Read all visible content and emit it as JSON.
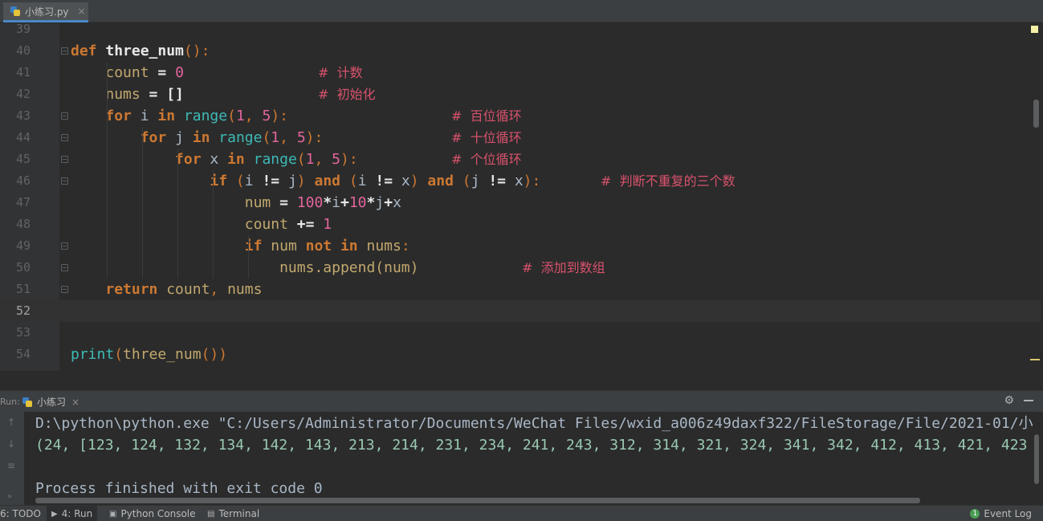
{
  "editor_tab": {
    "filename": "小练习.py",
    "close": "×"
  },
  "code_lines": [
    {
      "num": "39"
    },
    {
      "num": "40",
      "tokens": [
        [
          "kw",
          "def "
        ],
        [
          "fn",
          "three_num"
        ],
        [
          "punc",
          "():"
        ]
      ]
    },
    {
      "num": "41",
      "tokens": [
        [
          "pl",
          "    "
        ],
        [
          "id",
          "count "
        ],
        [
          "op",
          "= "
        ],
        [
          "num",
          "0"
        ]
      ],
      "comment": "#  计数",
      "comment_col": 396
    },
    {
      "num": "42",
      "tokens": [
        [
          "pl",
          "    "
        ],
        [
          "id",
          "nums "
        ],
        [
          "op",
          "= []"
        ]
      ],
      "comment": "#  初始化",
      "comment_col": 396
    },
    {
      "num": "43",
      "tokens": [
        [
          "pl",
          "    "
        ],
        [
          "kw",
          "for "
        ],
        [
          "pl",
          "i "
        ],
        [
          "kw",
          "in "
        ],
        [
          "bi",
          "range"
        ],
        [
          "punc",
          "("
        ],
        [
          "num",
          "1"
        ],
        [
          "punc",
          ", "
        ],
        [
          "num",
          "5"
        ],
        [
          "punc",
          "):"
        ]
      ],
      "comment": "#  百位循环",
      "comment_col": 562
    },
    {
      "num": "44",
      "tokens": [
        [
          "pl",
          "        "
        ],
        [
          "kw",
          "for "
        ],
        [
          "pl",
          "j "
        ],
        [
          "kw",
          "in "
        ],
        [
          "bi",
          "range"
        ],
        [
          "punc",
          "("
        ],
        [
          "num",
          "1"
        ],
        [
          "punc",
          ", "
        ],
        [
          "num",
          "5"
        ],
        [
          "punc",
          "):"
        ]
      ],
      "comment": "#  十位循环",
      "comment_col": 562
    },
    {
      "num": "45",
      "tokens": [
        [
          "pl",
          "            "
        ],
        [
          "kw",
          "for "
        ],
        [
          "pl",
          "x "
        ],
        [
          "kw",
          "in "
        ],
        [
          "bi",
          "range"
        ],
        [
          "punc",
          "("
        ],
        [
          "num",
          "1"
        ],
        [
          "punc",
          ", "
        ],
        [
          "num",
          "5"
        ],
        [
          "punc",
          "):"
        ]
      ],
      "comment": "#  个位循环",
      "comment_col": 562
    },
    {
      "num": "46",
      "tokens": [
        [
          "pl",
          "                "
        ],
        [
          "kw",
          "if "
        ],
        [
          "punc",
          "("
        ],
        [
          "pl",
          "i "
        ],
        [
          "op",
          "!= "
        ],
        [
          "pl",
          "j"
        ],
        [
          "punc",
          ") "
        ],
        [
          "kw",
          "and "
        ],
        [
          "punc",
          "("
        ],
        [
          "pl",
          "i "
        ],
        [
          "op",
          "!= "
        ],
        [
          "pl",
          "x"
        ],
        [
          "punc",
          ") "
        ],
        [
          "kw",
          "and "
        ],
        [
          "punc",
          "("
        ],
        [
          "pl",
          "j "
        ],
        [
          "op",
          "!= "
        ],
        [
          "pl",
          "x"
        ],
        [
          "punc",
          "):"
        ]
      ],
      "comment": "#  判断不重复的三个数",
      "comment_col": 748
    },
    {
      "num": "47",
      "tokens": [
        [
          "pl",
          "                    "
        ],
        [
          "id",
          "num "
        ],
        [
          "op",
          "= "
        ],
        [
          "num",
          "100"
        ],
        [
          "op",
          "*"
        ],
        [
          "pl",
          "i"
        ],
        [
          "op",
          "+"
        ],
        [
          "num",
          "10"
        ],
        [
          "op",
          "*"
        ],
        [
          "pl",
          "j"
        ],
        [
          "op",
          "+"
        ],
        [
          "pl",
          "x"
        ]
      ]
    },
    {
      "num": "48",
      "tokens": [
        [
          "pl",
          "                    "
        ],
        [
          "id",
          "count "
        ],
        [
          "op",
          "+= "
        ],
        [
          "num",
          "1"
        ]
      ]
    },
    {
      "num": "49",
      "tokens": [
        [
          "pl",
          "                    "
        ],
        [
          "kw",
          "if "
        ],
        [
          "id",
          "num "
        ],
        [
          "kw",
          "not in "
        ],
        [
          "id",
          "nums"
        ],
        [
          "punc",
          ":"
        ]
      ]
    },
    {
      "num": "50",
      "tokens": [
        [
          "pl",
          "                        "
        ],
        [
          "id",
          "nums.append(num)"
        ]
      ],
      "comment": "#  添加到数组",
      "comment_col": 650
    },
    {
      "num": "51",
      "tokens": [
        [
          "pl",
          "    "
        ],
        [
          "kw",
          "return "
        ],
        [
          "id",
          "count"
        ],
        [
          "punc",
          ", "
        ],
        [
          "id",
          "nums"
        ]
      ]
    },
    {
      "num": "52",
      "current": true
    },
    {
      "num": "53"
    },
    {
      "num": "54",
      "tokens": [
        [
          "bi",
          "print"
        ],
        [
          "punc",
          "("
        ],
        [
          "id",
          "three_num"
        ],
        [
          "punc",
          "())"
        ]
      ]
    }
  ],
  "run_panel": {
    "prefix": "Run:",
    "tab_label": "小练习",
    "tab_close": "×",
    "settings_icon": "gear-icon",
    "output": {
      "command": "D:\\python\\python.exe \"C:/Users/Administrator/Documents/WeChat Files/wxid_a006z49daxf322/FileStorage/File/2021-01/小",
      "result": "(24, [123, 124, 132, 134, 142, 143, 213, 214, 231, 234, 241, 243, 312, 314, 321, 324, 341, 342, 412, 413, 421, 423",
      "process": "Process finished with exit code 0"
    }
  },
  "bottom_bar": {
    "todo": "6: TODO",
    "run": "4: Run",
    "python_console": "Python Console",
    "terminal": "Terminal",
    "event_log": "Event Log",
    "event_count": "1"
  },
  "colors": {
    "background": "#2b2b2b",
    "keyword": "#cc7832",
    "number": "#e2659c",
    "builtin": "#3dbab6",
    "comment": "#d8526c",
    "identifier": "#c2a86e",
    "output_result": "#99c9b2"
  }
}
